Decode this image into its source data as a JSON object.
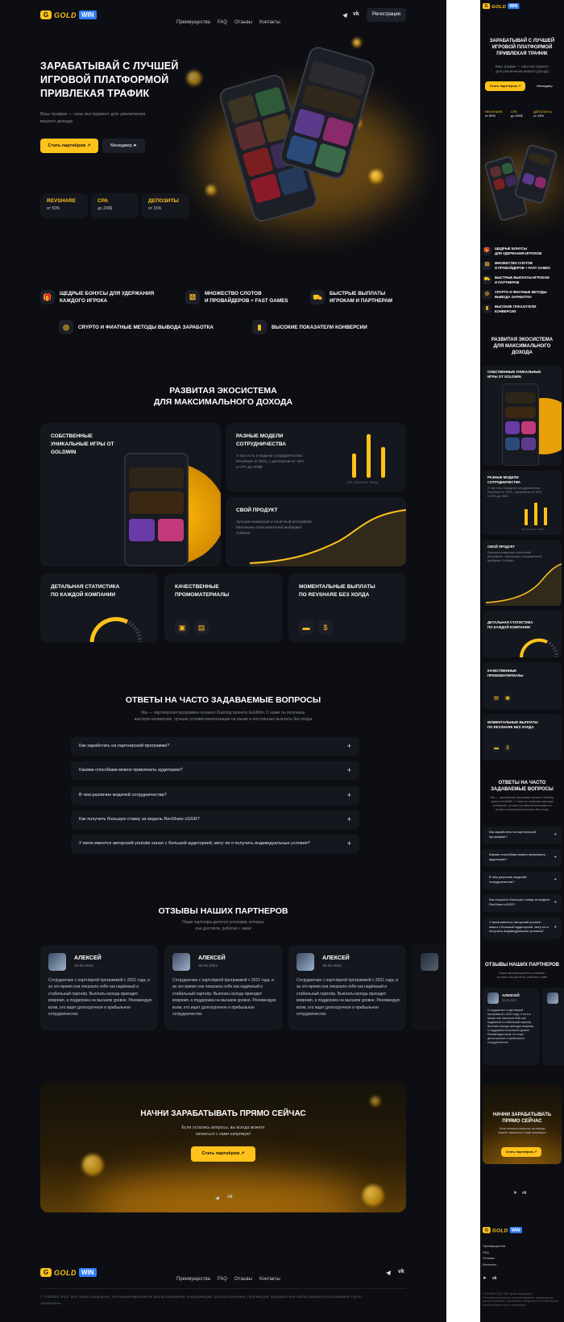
{
  "brand": {
    "g": "G",
    "gold": "GOLD",
    "win": "WIN"
  },
  "nav": [
    "Преимущества",
    "FAQ",
    "Отзывы",
    "Контакты"
  ],
  "icons": {
    "telegram": "telegram-icon",
    "vk": "vk-icon"
  },
  "header": {
    "register": "Регистрация"
  },
  "hero": {
    "title": "ЗАРАБАТЫВАЙ С ЛУЧШЕЙ ИГРОВОЙ ПЛАТФОРМОЙ ПРИВЛЕКАЯ ТРАФИК",
    "title_l1": "ЗАРАБАТЫВАЙ С ЛУЧШЕЙ",
    "title_l2": "ИГРОВОЙ ПЛАТФОРМОЙ",
    "title_l3": "ПРИВЛЕКАЯ ТРАФИК",
    "subtitle_l1": "Ваш трафик — наш инструмент для увеличения",
    "subtitle_l2": "вашего дохода",
    "btn_partner": "Стать партнёром",
    "btn_manager": "Менеджер",
    "stats": [
      {
        "title": "REVSHARE",
        "value": "от 50%"
      },
      {
        "title": "CPA",
        "value": "до 200$"
      },
      {
        "title": "ДЕПОЗИТЫ",
        "value": "от 15%"
      }
    ]
  },
  "benefits": [
    {
      "icon": "gift-icon",
      "l1": "ЩЕДРЫЕ БОНУСЫ ДЛЯ УДЕРЖАНИЯ",
      "l2": "КАЖДОГО ИГРОКА"
    },
    {
      "icon": "dice-icon",
      "l1": "МНОЖЕСТВО СЛОТОВ",
      "l2": "И ПРОВАЙДЕРОВ + FAST GAMES"
    },
    {
      "icon": "truck-icon",
      "l1": "БЫСТРЫЕ ВЫПЛАТЫ",
      "l2": "ИГРОКАМ И ПАРТНЕРАМ"
    },
    {
      "icon": "coins-icon",
      "l1": "CRYPTO И ФИАТНЫЕ МЕТОДЫ ВЫВОДА ЗАРАБОТКА",
      "l2": ""
    },
    {
      "icon": "chart-bars-icon",
      "l1": "ВЫСОКИЕ ПОКАЗАТЕЛИ КОНВЕРСИИ",
      "l2": ""
    }
  ],
  "eco": {
    "title_l1": "РАЗВИТАЯ ЭКОСИСТЕМА",
    "title_l2": "ДЛЯ МАКСИМАЛЬНОГО ДОХОДА",
    "own_l1": "СОБСТВЕННЫЕ",
    "own_l2": "УНИКАЛЬНЫЕ ИГРЫ ОТ",
    "own_l3": "GOLDWIN",
    "models_l1": "РАЗНЫЕ МОДЕЛИ",
    "models_l2": "СОТРУДНИЧЕСТВА",
    "models_d1": "У нас есть 3 модели сотрудничества:",
    "models_d2": "RevShare от 50%, с депозитов от 15%",
    "models_d3": "и CPA до 200$",
    "bar_labels": [
      "CPA",
      "RevShare",
      "Hibrig"
    ],
    "product": "СВОЙ ПРОДУКТ",
    "product_d1": "Лучшая конверсия и понятный интерфейс.",
    "product_d2": "Миллионы пользователей выбирают",
    "product_d3": "Goldwin.",
    "stats_l1": "ДЕТАЛЬНАЯ СТАТИСТИКА",
    "stats_l2": "ПО КАЖДОЙ КОМПАНИИ",
    "promo_l1": "КАЧЕСТВЕННЫЕ",
    "promo_l2": "ПРОМОМАТЕРИАЛЫ",
    "pay_l1": "МОМЕНТАЛЬНЫЕ ВЫПЛАТЫ",
    "pay_l2": "ПО REVSHARE БЕЗ ХОЛДА"
  },
  "faq": {
    "title": "ОТВЕТЫ НА ЧАСТО   ЗАДАВАЕМЫЕ ВОПРОСЫ",
    "sub_l1": "Мы — партнёрская программа лучшего iGaming проекта GoldWin. С нами ты получишь",
    "sub_l2": "высокую конверсию, лучшие условия монетизации на рынке и постоянные выплаты без холда",
    "items": [
      "Как заработать на партнерской программе?",
      "Какими способами можно привлекать аудиторию?",
      "В чем различия моделей сотрудничества?",
      "Как получить большую ставку за модель RevShare cGGR?",
      "У меня имеется авторский youtube канал с большой аудиторией, могу ли я получить индивидуальные условия?"
    ]
  },
  "reviews": {
    "title": "ОТЗЫВЫ НАШИХ ПАРТНЕРОВ",
    "sub_l1": "Наши партнеры делятся успехами, которых",
    "sub_l2": "они достигли, работая с нами",
    "items": [
      {
        "name": "АЛЕКСЕЙ",
        "date": "30.05.2023",
        "text": "Сотрудничаю с партнёркой программой с 2021 года, и за это время она показала себя как надёжный и стабильный партнёр. Выплаты всегда приходят вовремя, а поддержка на высшем уровне. Рекомендую всем, кто ищет долгосрочное и прибыльное сотрудничество"
      },
      {
        "name": "АЛЕКСЕЙ",
        "date": "30.05.2023",
        "text": "Сотрудничаю с партнёркой программой с 2021 года, и за это время она показала себя как надёжный и стабильный партнёр. Выплаты всегда приходят вовремя, а поддержка на высшем уровне. Рекомендую всем, кто ищет долгосрочное и прибыльное сотрудничество"
      },
      {
        "name": "АЛЕКСЕЙ",
        "date": "30.05.2023",
        "text": "Сотрудничаю с партнёркой программой с 2021 года, и за это время она показала себя как надёжный и стабильный партнёр. Выплаты всегда приходят вовремя, а поддержка на высшем уровне. Рекомендую всем, кто ищет долгосрочное и прибыльное сотрудничество"
      }
    ]
  },
  "cta": {
    "title": "НАЧНИ ЗАРАБАТЫВАТЬ ПРЯМО СЕЙЧАС",
    "sub_l1": "Если остались вопросы, вы всегда можете",
    "sub_l2": "связаться с нами напрямую!",
    "btn": "Стать партнёром"
  },
  "footer": {
    "copyright": "© GoldWin 2024. Все права защищены. Несанкционированное воспроизведение, модификация, распространение, публикация, передача или любая форма использования строго запрещены."
  },
  "mobile": {
    "title_l1": "ЗАРАБАТЫВАЙ С ЛУЧШЕЙ",
    "title_l2": "ИГРОВОЙ ПЛАТФОРМОЙ",
    "title_l3": "ПРИВЛЕКАЯ ТРАФИК",
    "sub_l1": "Ваш трафик — наш инструмент",
    "sub_l2": "для увеличения вашего дохода",
    "btn_partner": "Стать партнёром",
    "btn_manager": "Менеджер",
    "ben": [
      [
        "ЩЕДРЫЕ БОНУСЫ",
        "ДЛЯ УДЕРЖАНИЯ ИГРОКОВ"
      ],
      [
        "МНОЖЕСТВО СЛОТОВ",
        "И ПРОВАЙДЕРОВ + FAST GAMES"
      ],
      [
        "БЫСТРЫЕ ВЫПЛАТЫ ИГРОКАМ",
        "И ПАРТНЕРАМ"
      ],
      [
        "CRYPTO И ФИАТНЫЕ МЕТОДЫ",
        "ВЫВОДА ЗАРАБОТКА"
      ],
      [
        "ВЫСОКИЕ ПОКАЗАТЕЛИ",
        "КОНВЕРСИИ"
      ]
    ],
    "eco_l1": "РАЗВИТАЯ ЭКОСИСТЕМА",
    "eco_l2": "ДЛЯ МАКСИМАЛЬНОГО",
    "eco_l3": "ДОХОДА",
    "own_l1": "СОБСТВЕННЫЕ УНИКАЛЬНЫЕ",
    "own_l2": "ИГРЫ ОТ GOLDWIN",
    "models_l1": "РАЗНЫЕ МОДЕЛИ",
    "models_l2": "СОТРУДНИЧЕСТВА",
    "models_d1": "У нас есть 3 модели сотрудничества:",
    "models_d2": "RevShare от 50%, с депозитов от 15%",
    "models_d3": "и CPA до 200$",
    "product_d1": "Лучшая конверсия и понятный",
    "product_d2": "интерфейс. Миллионы пользователей",
    "product_d3": "выбирают Goldwin.",
    "stats_l1": "ДЕТАЛЬНАЯ СТАТИСТИКА",
    "stats_l2": "ПО КАЖДОЙ КОМПАНИИ",
    "promo_l1": "КАЧЕСТВЕННЫЕ",
    "promo_l2": "ПРОМОМАТЕРИАЛЫ",
    "pay_l1": "МОМЕНТАЛЬНЫЕ ВЫПЛАТЫ",
    "pay_l2": "ПО REVSHARE БЕЗ ХОЛДА",
    "faq_l1": "ОТВЕТЫ НА ЧАСТО",
    "faq_l2": "ЗАДАВАЕМЫЕ ВОПРОСЫ",
    "faq_s1": "Мы — партнёрская программа лучшего iGaming",
    "faq_s2": "проекта GoldWin. С нами ты получишь высокую",
    "faq_s3": "конверсию, лучшие условия монетизации на",
    "faq_s4": "рынке и постоянные выплаты без холда",
    "rev_s1": "Наши партнеры делятся успехами,",
    "rev_s2": "которых они достигли, работая с нами",
    "rev_text": "Сотрудничаю с партнёркой программой с 2021 года, и за это время она показала себя как надёжный и стабильный партнёр. Выплаты всегда приходят вовремя, а поддержка на высшем уровне. Рекомендую всем, кто ищет долгосрочное и прибыльное сотрудничество",
    "cta_l1": "НАЧНИ ЗАРАБАТЫВАТЬ",
    "cta_l2": "ПРЯМО СЕЙЧАС",
    "cta_s1": "Если остались вопросы, вы всегда",
    "cta_s2": "можете связаться с нами напрямую!"
  },
  "colors": {
    "accent": "#ffc21a",
    "bg": "#0d0e13",
    "card": "#15171e",
    "brand_blue": "#2f7ef6"
  }
}
